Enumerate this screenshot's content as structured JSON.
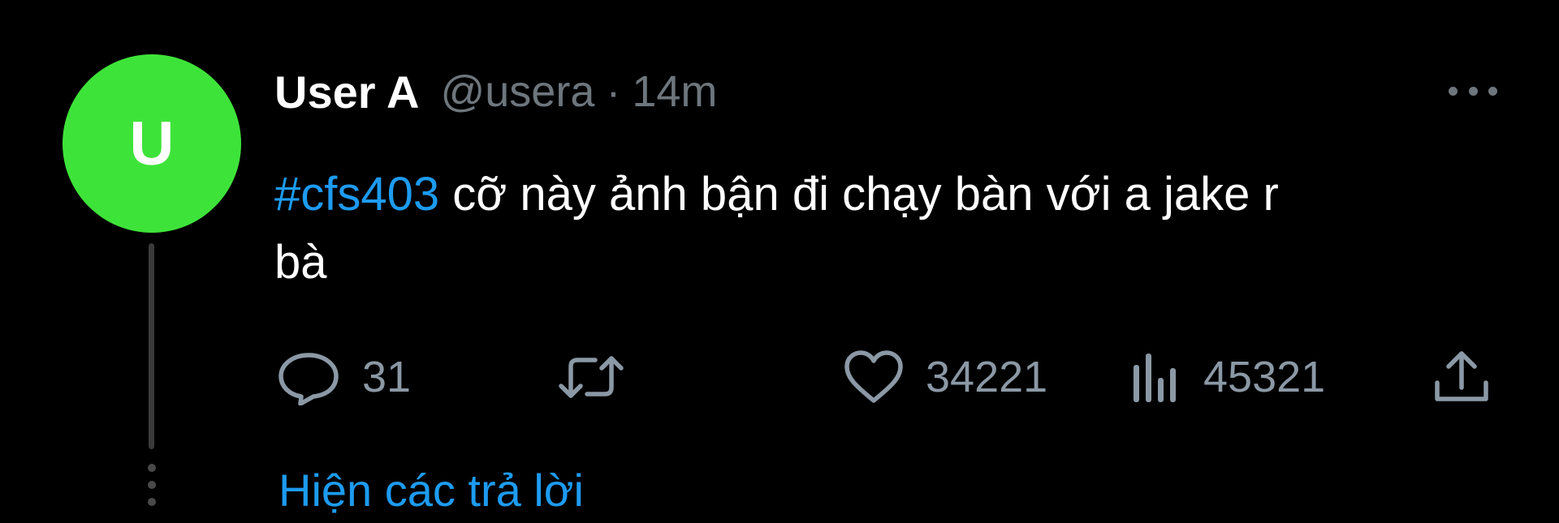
{
  "tweet": {
    "avatar_letter": "U",
    "avatar_color": "#3ee33a",
    "display_name": "User A",
    "handle": "@usera",
    "separator": "·",
    "time": "14m",
    "hashtag": "#cfs403",
    "hashtag_color": "#1d9bf0",
    "text_line1": " cỡ này ảnh bận đi chạy bàn với a jake r",
    "text_line2": "bà",
    "more_icon": "more-horizontal-icon"
  },
  "actions": {
    "reply": {
      "icon": "reply-icon",
      "count": "31"
    },
    "retweet": {
      "icon": "retweet-icon"
    },
    "like": {
      "icon": "heart-icon",
      "count": "34221"
    },
    "views": {
      "icon": "bar-chart-icon",
      "count": "45321"
    },
    "share": {
      "icon": "share-icon"
    }
  },
  "show_replies_label": "Hiện các trả lời"
}
